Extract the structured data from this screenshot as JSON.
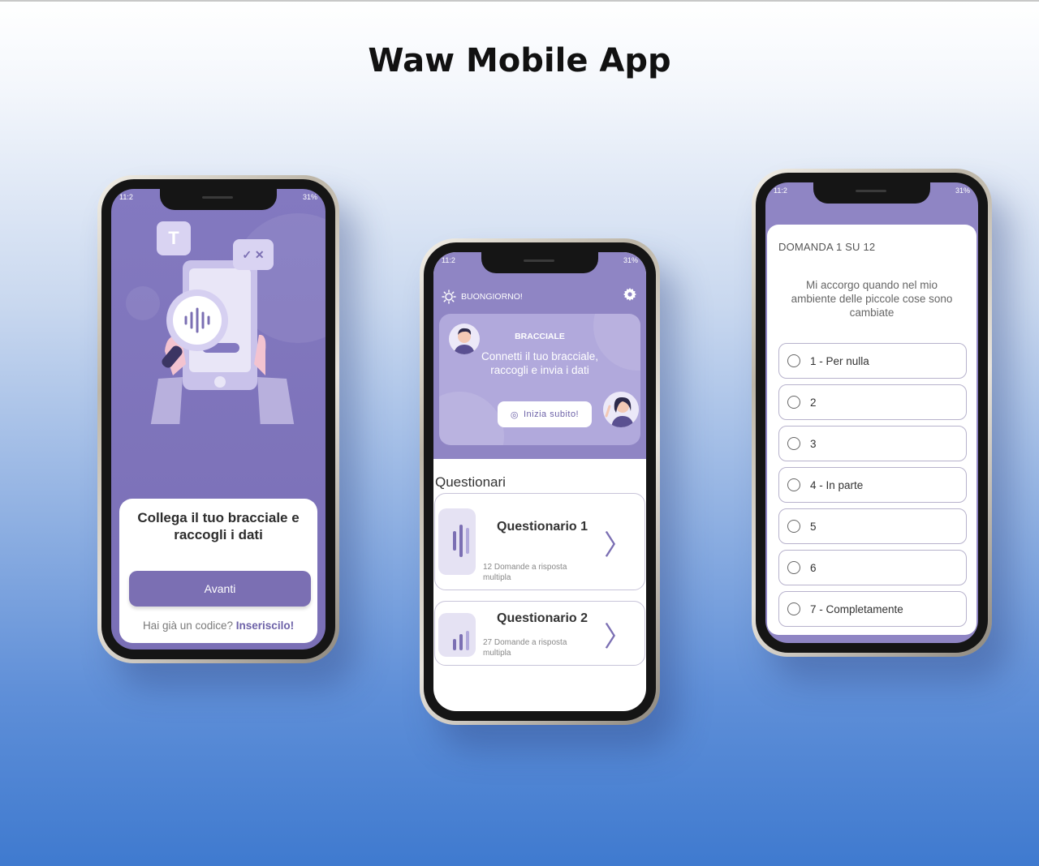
{
  "page": {
    "title": "Waw Mobile App"
  },
  "phone1": {
    "status_time": "11:2",
    "status_battery": "31%",
    "illustration_letter": "T",
    "card_title": "Collega il tuo bracciale e raccogli i dati",
    "button_label": "Avanti",
    "code_question": "Hai già un codice?",
    "code_link": "Inseriscilo!"
  },
  "phone2": {
    "status_time": "11:2",
    "status_battery": "31%",
    "greeting": "BUONGIORNO!",
    "banner": {
      "kicker": "BRACCIALE",
      "text": "Connetti il tuo bracciale, raccogli e invia i dati",
      "button_label": "Inizia subito!"
    },
    "section_title": "Questionari",
    "questionnaires": [
      {
        "name": "Questionario 1",
        "subtitle": "12 Domande a risposta multipla"
      },
      {
        "name": "Questionario 2",
        "subtitle": "27 Domande a risposta multipla"
      }
    ]
  },
  "phone3": {
    "status_time": "11:2",
    "status_battery": "31%",
    "question_counter": "DOMANDA  1 SU 12",
    "question_text": "Mi accorgo quando nel mio ambiente delle piccole cose sono cambiate",
    "options": [
      "1 - Per nulla",
      "2",
      "3",
      "4 - In parte",
      "5",
      "6",
      "7 - Completamente"
    ]
  },
  "colors": {
    "primary": "#7b6fb3",
    "header": "#8f85c4",
    "banner": "#b1a9dc"
  }
}
